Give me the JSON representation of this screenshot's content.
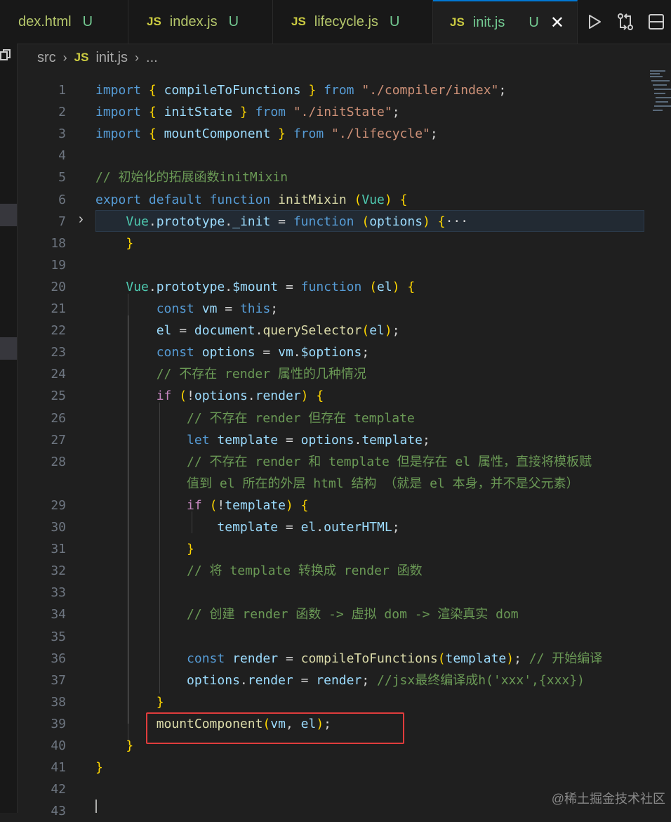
{
  "tabs": [
    {
      "name": "dex.html",
      "status": "U",
      "icon": "html-file-icon",
      "active": false
    },
    {
      "name": "index.js",
      "status": "U",
      "icon": "js-file-icon",
      "active": false
    },
    {
      "name": "lifecycle.js",
      "status": "U",
      "icon": "js-file-icon",
      "active": false
    },
    {
      "name": "init.js",
      "status": "U",
      "icon": "js-file-icon",
      "active": true
    }
  ],
  "tab_icon_text": "JS",
  "close_glyph": "✕",
  "actions": [
    "run-icon",
    "compare-changes-icon",
    "split-editor-icon"
  ],
  "breadcrumb": {
    "folder": "src",
    "icon_text": "JS",
    "file": "init.js",
    "more": "..."
  },
  "editor": {
    "line_numbers": [
      "1",
      "2",
      "3",
      "4",
      "5",
      "6",
      "7",
      "18",
      "19",
      "20",
      "21",
      "22",
      "23",
      "24",
      "25",
      "26",
      "27",
      "28",
      "",
      "29",
      "30",
      "31",
      "32",
      "33",
      "34",
      "35",
      "36",
      "37",
      "38",
      "39",
      "40",
      "41",
      "42",
      "43"
    ],
    "collapsed_line": "7",
    "highlighted_line": "39",
    "code_lines": [
      "import { compileToFunctions } from \"./compiler/index\";",
      "import { initState } from \"./initState\";",
      "import { mountComponent } from \"./lifecycle\";",
      "",
      "// 初始化的拓展函数initMixin",
      "export default function initMixin (Vue) {",
      "    Vue.prototype._init = function (options) {···",
      "    }",
      "",
      "    Vue.prototype.$mount = function (el) {",
      "        const vm = this;",
      "        el = document.querySelector(el);",
      "        const options = vm.$options;",
      "        // 不存在 render 属性的几种情况",
      "        if (!options.render) {",
      "            // 不存在 render 但存在 template",
      "            let template = options.template;",
      "            // 不存在 render 和 template 但是存在 el 属性，直接将模板赋",
      "            值到 el 所在的外层 html 结构 （就是 el 本身，并不是父元素）",
      "            if (!template) {",
      "                template = el.outerHTML;",
      "            }",
      "            // 将 template 转换成 render 函数",
      "",
      "            // 创建 render 函数 -> 虚拟 dom -> 渲染真实 dom",
      "",
      "            const render = compileToFunctions(template); // 开始编译",
      "            options.render = render; //jsx最终编译成h('xxx',{xxx})",
      "        }",
      "        mountComponent(vm, el);",
      "    }",
      "}",
      "",
      ""
    ]
  },
  "watermark": "@稀土掘金技术社区",
  "colors": {
    "keyword": "#569cd6",
    "control": "#c586c0",
    "function": "#dcdcaa",
    "string": "#ce9178",
    "variable": "#9cdcfe",
    "class": "#4ec9b0",
    "comment": "#6a9955",
    "highlight_box": "#e03c3c"
  }
}
